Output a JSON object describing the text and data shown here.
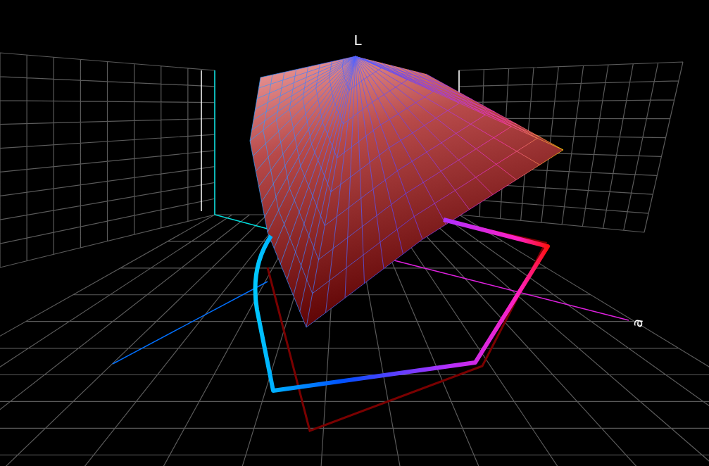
{
  "axes": [
    {
      "label": "L"
    },
    {
      "label": "a"
    }
  ]
}
